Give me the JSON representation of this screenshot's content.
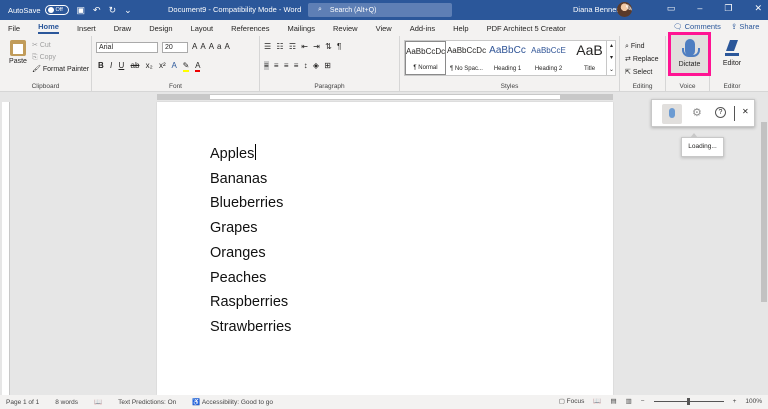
{
  "title_bar": {
    "autosave_label": "AutoSave",
    "autosave_state": "Off",
    "document_title": "Document9 - Compatibility Mode - Word",
    "search_placeholder": "Search (Alt+Q)",
    "user_name": "Diana Benner"
  },
  "ribbon_tabs": [
    "File",
    "Home",
    "Insert",
    "Draw",
    "Design",
    "Layout",
    "References",
    "Mailings",
    "Review",
    "View",
    "Add-ins",
    "Help",
    "PDF Architect 5 Creator"
  ],
  "active_tab": "Home",
  "comments_label": "Comments",
  "share_label": "Share",
  "clipboard": {
    "paste_label": "Paste",
    "cut_label": "Cut",
    "copy_label": "Copy",
    "format_painter_label": "Format Painter",
    "group_label": "Clipboard"
  },
  "font": {
    "font_name": "Arial",
    "font_size": "20",
    "group_label": "Font"
  },
  "paragraph": {
    "group_label": "Paragraph"
  },
  "styles": {
    "items": [
      {
        "sample": "AaBbCcDc",
        "name": "¶ Normal"
      },
      {
        "sample": "AaBbCcDc",
        "name": "¶ No Spac..."
      },
      {
        "sample": "AaBbCc",
        "name": "Heading 1"
      },
      {
        "sample": "AaBbCcE",
        "name": "Heading 2"
      },
      {
        "sample": "AaB",
        "name": "Title"
      }
    ],
    "group_label": "Styles"
  },
  "editing": {
    "find_label": "Find",
    "replace_label": "Replace",
    "select_label": "Select",
    "group_label": "Editing"
  },
  "voice": {
    "dictate_label": "Dictate",
    "group_label": "Voice"
  },
  "editor": {
    "editor_label": "Editor",
    "group_label": "Editor"
  },
  "document": {
    "lines": [
      "Apples",
      "Bananas",
      "Blueberries",
      "Grapes",
      "Oranges",
      "Peaches",
      "Raspberries",
      "Strawberries"
    ]
  },
  "dictation_tooltip": "Loading...",
  "status_bar": {
    "page_info": "Page 1 of 1",
    "word_count": "8 words",
    "text_predictions": "Text Predictions: On",
    "accessibility": "Accessibility: Good to go",
    "focus_label": "Focus",
    "zoom": "100%"
  },
  "colors": {
    "title_bar": "#2b579a",
    "dictate_highlight": "#ff1493",
    "accent": "#2b579a"
  }
}
